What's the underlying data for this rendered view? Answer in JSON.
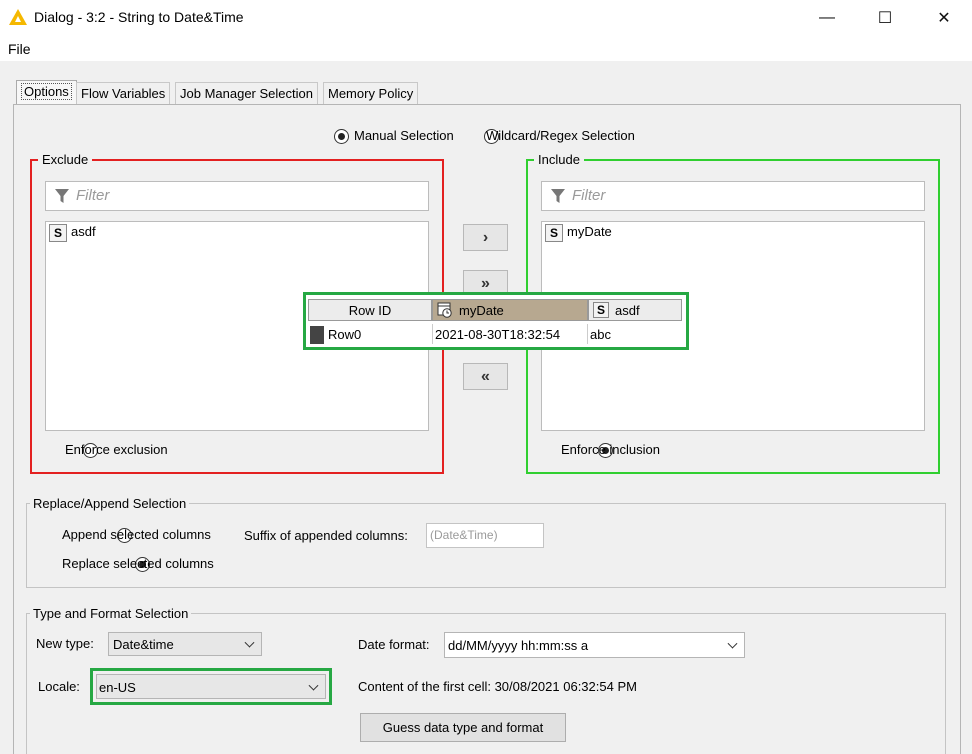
{
  "window": {
    "title": "Dialog - 3:2 - String to Date&Time",
    "minimize": "—",
    "maximize": "☐",
    "close": "✕"
  },
  "menu": {
    "file": "File"
  },
  "tabs": [
    {
      "label": "Options",
      "active": true
    },
    {
      "label": "Flow Variables"
    },
    {
      "label": "Job Manager Selection"
    },
    {
      "label": "Memory Policy"
    }
  ],
  "selection_mode": {
    "manual": "Manual Selection",
    "wildcard": "Wildcard/Regex Selection",
    "selected": "manual"
  },
  "exclude": {
    "title": "Exclude",
    "filter_placeholder": "Filter",
    "items": [
      {
        "type": "S",
        "name": "asdf"
      }
    ],
    "enforce_label": "Enforce exclusion",
    "enforce_checked": false
  },
  "include": {
    "title": "Include",
    "filter_placeholder": "Filter",
    "items": [
      {
        "type": "S",
        "name": "myDate"
      }
    ],
    "enforce_label": "Enforce inclusion",
    "enforce_checked": true
  },
  "move_buttons": {
    "add": "›",
    "add_all": "»",
    "remove_all": "«"
  },
  "preview_table": {
    "headers": {
      "row_id": "Row ID",
      "col1": "myDate",
      "col2": "asdf",
      "col2_type": "S"
    },
    "rows": [
      {
        "id": "Row0",
        "myDate": "2021-08-30T18:32:54",
        "asdf": "abc"
      }
    ]
  },
  "replace_append": {
    "title": "Replace/Append Selection",
    "append_label": "Append selected columns",
    "replace_label": "Replace selected columns",
    "selected": "replace",
    "suffix_label": "Suffix of appended columns:",
    "suffix_value": "(Date&Time)"
  },
  "type_format": {
    "title": "Type and Format Selection",
    "new_type_label": "New type:",
    "new_type_value": "Date&time",
    "date_format_label": "Date format:",
    "date_format_value": "dd/MM/yyyy hh:mm:ss a",
    "locale_label": "Locale:",
    "locale_value": "en-US",
    "content_label": "Content of the first cell: 30/08/2021 06:32:54 PM",
    "guess_button": "Guess data type and format"
  },
  "colors": {
    "exclude_border": "#e32020",
    "include_border": "#30cf30",
    "highlight_border": "#26a843",
    "knime_logo": "#f5b800"
  }
}
